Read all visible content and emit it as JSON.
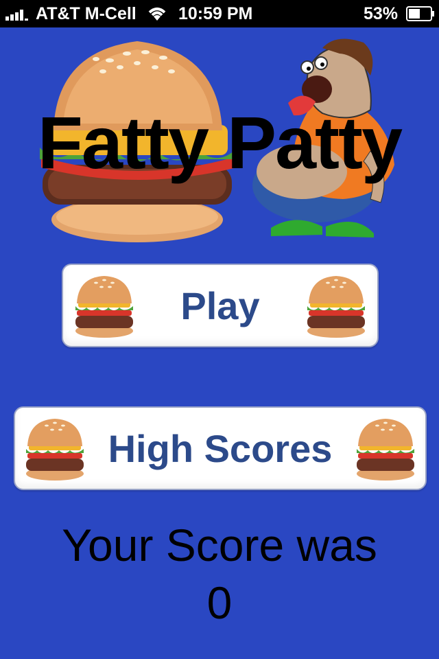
{
  "status_bar": {
    "carrier": "AT&T M-Cell",
    "time": "10:59 PM",
    "battery_percent": "53%",
    "battery_level": 0.53
  },
  "app": {
    "title": "Fatty Patty"
  },
  "menu": {
    "play_label": "Play",
    "high_scores_label": "High Scores"
  },
  "result": {
    "score_label": "Your Score was",
    "score_value": "0"
  },
  "colors": {
    "background": "#2a47c2",
    "button_text": "#2c4a8a",
    "status_bar": "#000000"
  },
  "icons": [
    "signal-bars-icon",
    "wifi-icon",
    "battery-icon",
    "burger-icon",
    "fat-man-illustration"
  ]
}
